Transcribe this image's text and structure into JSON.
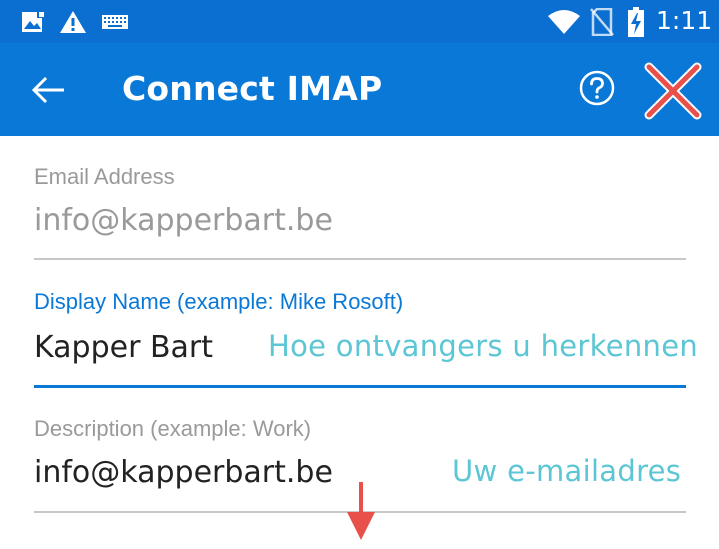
{
  "status_bar": {
    "time": "1:11",
    "icons": [
      "image-notification-icon",
      "warning-icon",
      "keyboard-icon",
      "wifi-icon",
      "no-sim-icon",
      "battery-charging-icon"
    ]
  },
  "app_bar": {
    "title": "Connect IMAP",
    "back_icon": "back-arrow-icon",
    "help_icon": "help-icon",
    "accent_color": "#0a78d7"
  },
  "form": {
    "email": {
      "label": "Email Address",
      "value": "info@kapperbart.be"
    },
    "display_name": {
      "label": "Display Name (example: Mike Rosoft)",
      "value": "Kapper Bart",
      "hint": "Hoe ontvangers u herkennen"
    },
    "description": {
      "label": "Description (example: Work)",
      "value": "info@kapperbart.be",
      "hint": "Uw e-mailadres"
    }
  },
  "annotations": {
    "hint_color": "#5cc6d4",
    "marker_color": "#e8504a"
  }
}
